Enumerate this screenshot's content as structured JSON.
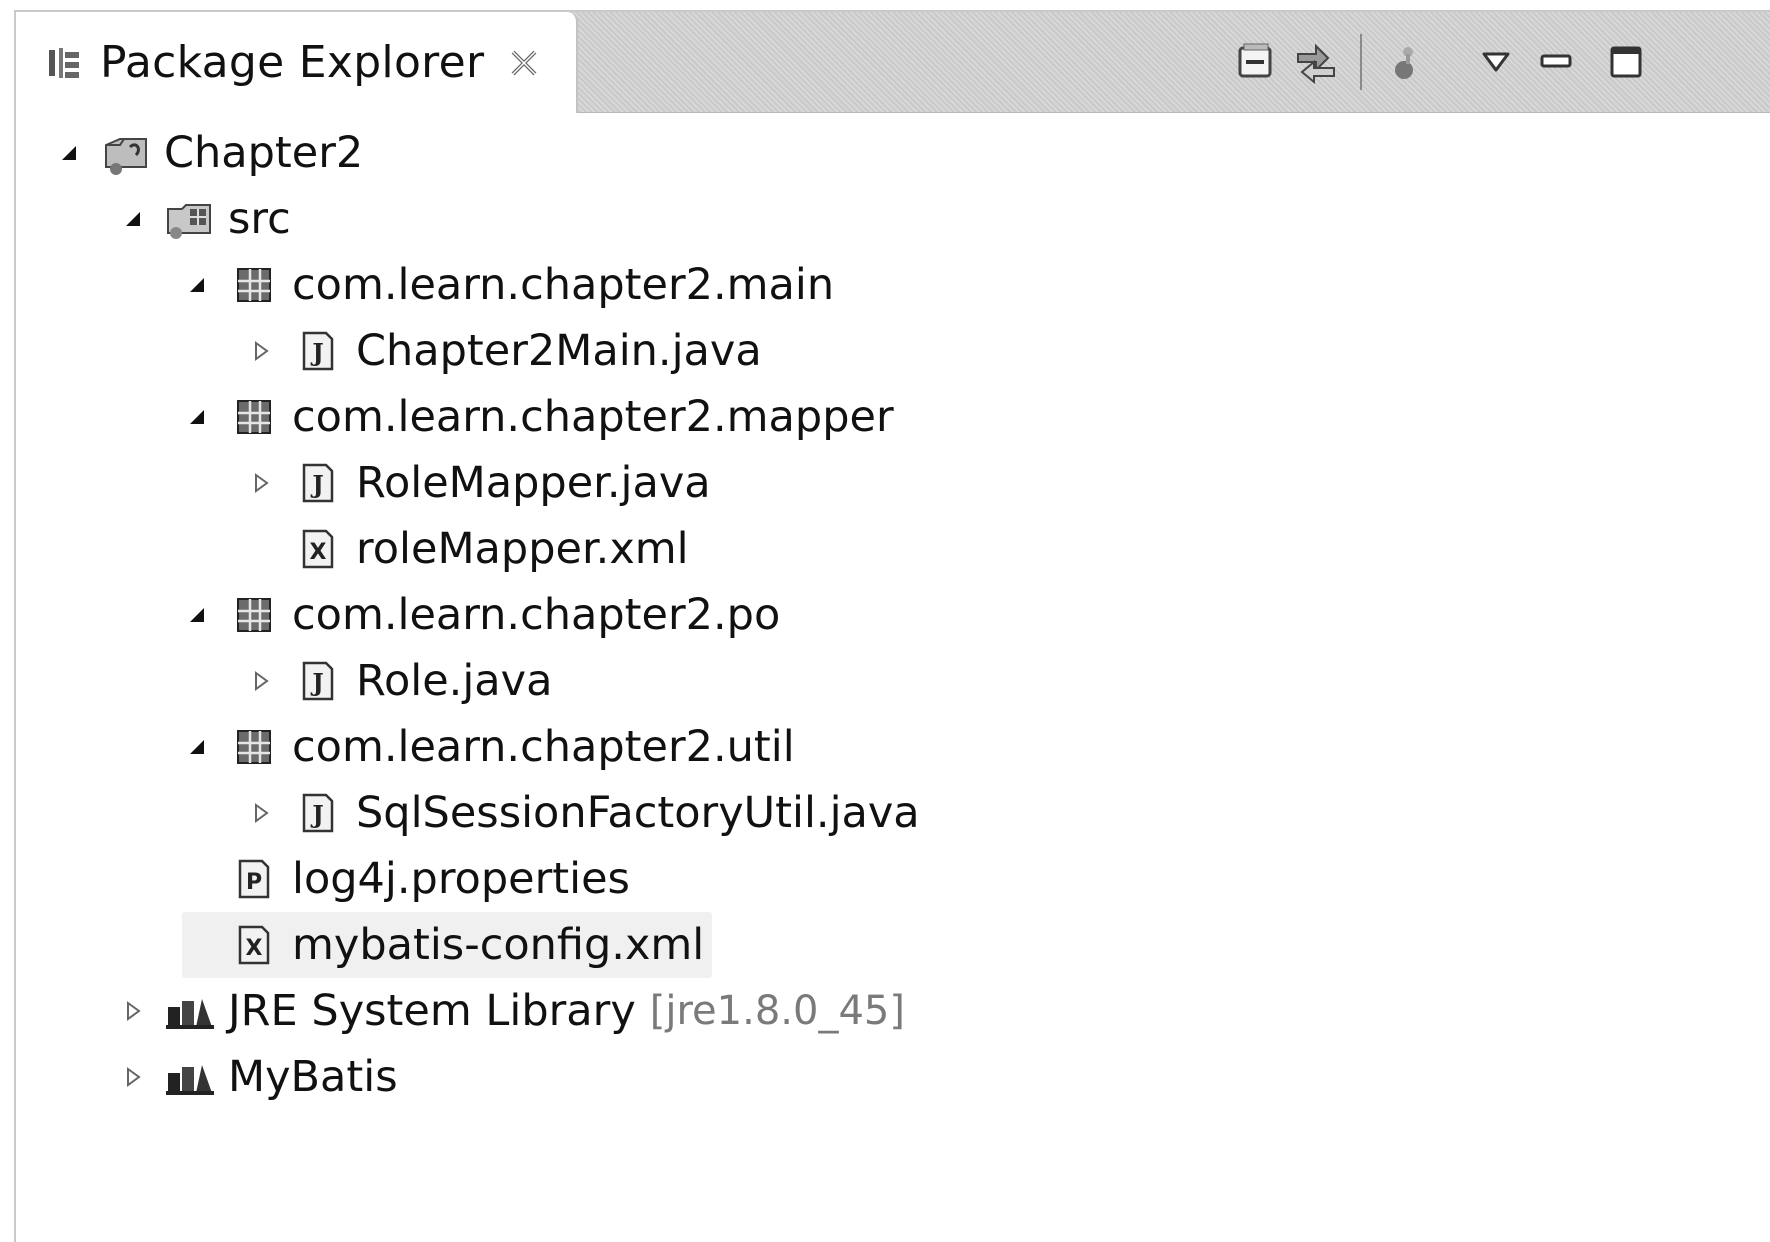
{
  "view": {
    "title": "Package Explorer",
    "tab_icon": "package-explorer-icon",
    "close_icon": "close-icon"
  },
  "toolbar": {
    "items": [
      {
        "name": "collapse-all-button",
        "icon": "collapse-all-icon"
      },
      {
        "name": "link-with-editor-button",
        "icon": "link-with-editor-icon"
      },
      {
        "name": "focus-button",
        "icon": "focus-icon"
      },
      {
        "name": "view-menu-button",
        "icon": "view-menu-icon"
      },
      {
        "name": "minimize-button",
        "icon": "minimize-icon"
      },
      {
        "name": "maximize-button",
        "icon": "maximize-icon"
      }
    ]
  },
  "tree": [
    {
      "label": "Chapter2",
      "icon": "java-project-icon",
      "twisty": "expanded",
      "depth": 0
    },
    {
      "label": "src",
      "icon": "source-folder-icon",
      "twisty": "expanded",
      "depth": 1
    },
    {
      "label": "com.learn.chapter2.main",
      "icon": "package-icon",
      "twisty": "expanded",
      "depth": 2
    },
    {
      "label": "Chapter2Main.java",
      "icon": "java-file-icon",
      "twisty": "collapsed",
      "depth": 3
    },
    {
      "label": "com.learn.chapter2.mapper",
      "icon": "package-icon",
      "twisty": "expanded",
      "depth": 2
    },
    {
      "label": "RoleMapper.java",
      "icon": "java-file-icon",
      "twisty": "collapsed",
      "depth": 3
    },
    {
      "label": "roleMapper.xml",
      "icon": "xml-file-icon",
      "twisty": "none",
      "depth": 3
    },
    {
      "label": "com.learn.chapter2.po",
      "icon": "package-icon",
      "twisty": "expanded",
      "depth": 2
    },
    {
      "label": "Role.java",
      "icon": "java-file-icon",
      "twisty": "collapsed",
      "depth": 3
    },
    {
      "label": "com.learn.chapter2.util",
      "icon": "package-icon",
      "twisty": "expanded",
      "depth": 2
    },
    {
      "label": "SqlSessionFactoryUtil.java",
      "icon": "java-file-icon",
      "twisty": "collapsed",
      "depth": 3
    },
    {
      "label": "log4j.properties",
      "icon": "properties-file-icon",
      "twisty": "none",
      "depth": 2
    },
    {
      "label": "mybatis-config.xml",
      "icon": "xml-file-icon",
      "twisty": "none",
      "depth": 2,
      "selected": true
    },
    {
      "label": "JRE System Library",
      "decoration": "[jre1.8.0_45]",
      "icon": "library-icon",
      "twisty": "collapsed",
      "depth": 1
    },
    {
      "label": "MyBatis",
      "icon": "library-icon",
      "twisty": "collapsed",
      "depth": 1
    }
  ]
}
